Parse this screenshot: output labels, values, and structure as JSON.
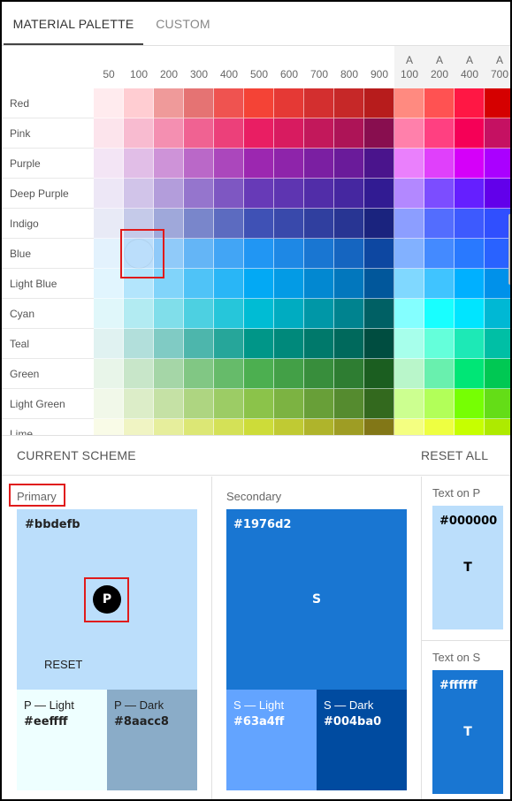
{
  "tabs": [
    {
      "label": "MATERIAL PALETTE",
      "active": true
    },
    {
      "label": "CUSTOM",
      "active": false
    }
  ],
  "palette": {
    "columns": [
      {
        "label": "50",
        "accent_prefix": ""
      },
      {
        "label": "100",
        "accent_prefix": ""
      },
      {
        "label": "200",
        "accent_prefix": ""
      },
      {
        "label": "300",
        "accent_prefix": ""
      },
      {
        "label": "400",
        "accent_prefix": ""
      },
      {
        "label": "500",
        "accent_prefix": ""
      },
      {
        "label": "600",
        "accent_prefix": ""
      },
      {
        "label": "700",
        "accent_prefix": ""
      },
      {
        "label": "800",
        "accent_prefix": ""
      },
      {
        "label": "900",
        "accent_prefix": ""
      },
      {
        "label": "100",
        "accent_prefix": "A"
      },
      {
        "label": "200",
        "accent_prefix": "A"
      },
      {
        "label": "400",
        "accent_prefix": "A"
      },
      {
        "label": "700",
        "accent_prefix": "A"
      }
    ],
    "rows": [
      {
        "name": "Red",
        "colors": [
          "#ffebee",
          "#ffcdd2",
          "#ef9a9a",
          "#e57373",
          "#ef5350",
          "#f44336",
          "#e53935",
          "#d32f2f",
          "#c62828",
          "#b71c1c",
          "#ff8a80",
          "#ff5252",
          "#ff1744",
          "#d50000"
        ]
      },
      {
        "name": "Pink",
        "colors": [
          "#fce4ec",
          "#f8bbd0",
          "#f48fb1",
          "#f06292",
          "#ec407a",
          "#e91e63",
          "#d81b60",
          "#c2185b",
          "#ad1457",
          "#880e4f",
          "#ff80ab",
          "#ff4081",
          "#f50057",
          "#c51162"
        ]
      },
      {
        "name": "Purple",
        "colors": [
          "#f3e5f5",
          "#e1bee7",
          "#ce93d8",
          "#ba68c8",
          "#ab47bc",
          "#9c27b0",
          "#8e24aa",
          "#7b1fa2",
          "#6a1b9a",
          "#4a148c",
          "#ea80fc",
          "#e040fb",
          "#d500f9",
          "#aa00ff"
        ]
      },
      {
        "name": "Deep Purple",
        "colors": [
          "#ede7f6",
          "#d1c4e9",
          "#b39ddb",
          "#9575cd",
          "#7e57c2",
          "#673ab7",
          "#5e35b1",
          "#512da8",
          "#4527a0",
          "#311b92",
          "#b388ff",
          "#7c4dff",
          "#651fff",
          "#6200ea"
        ]
      },
      {
        "name": "Indigo",
        "colors": [
          "#e8eaf6",
          "#c5cae9",
          "#9fa8da",
          "#7986cb",
          "#5c6bc0",
          "#3f51b5",
          "#3949ab",
          "#303f9f",
          "#283593",
          "#1a237e",
          "#8c9eff",
          "#536dfe",
          "#3d5afe",
          "#304ffe"
        ]
      },
      {
        "name": "Blue",
        "colors": [
          "#e3f2fd",
          "#bbdefb",
          "#90caf9",
          "#64b5f6",
          "#42a5f5",
          "#2196f3",
          "#1e88e5",
          "#1976d2",
          "#1565c0",
          "#0d47a1",
          "#82b1ff",
          "#448aff",
          "#2979ff",
          "#2962ff"
        ]
      },
      {
        "name": "Light Blue",
        "colors": [
          "#e1f5fe",
          "#b3e5fc",
          "#81d4fa",
          "#4fc3f7",
          "#29b6f6",
          "#03a9f4",
          "#039be5",
          "#0288d1",
          "#0277bd",
          "#01579b",
          "#80d8ff",
          "#40c4ff",
          "#00b0ff",
          "#0091ea"
        ]
      },
      {
        "name": "Cyan",
        "colors": [
          "#e0f7fa",
          "#b2ebf2",
          "#80deea",
          "#4dd0e1",
          "#26c6da",
          "#00bcd4",
          "#00acc1",
          "#0097a7",
          "#00838f",
          "#006064",
          "#84ffff",
          "#18ffff",
          "#00e5ff",
          "#00b8d4"
        ]
      },
      {
        "name": "Teal",
        "colors": [
          "#e0f2f1",
          "#b2dfdb",
          "#80cbc4",
          "#4db6ac",
          "#26a69a",
          "#009688",
          "#00897b",
          "#00796b",
          "#00695c",
          "#004d40",
          "#a7ffeb",
          "#64ffda",
          "#1de9b6",
          "#00bfa5"
        ]
      },
      {
        "name": "Green",
        "colors": [
          "#e8f5e9",
          "#c8e6c9",
          "#a5d6a7",
          "#81c784",
          "#66bb6a",
          "#4caf50",
          "#43a047",
          "#388e3c",
          "#2e7d32",
          "#1b5e20",
          "#b9f6ca",
          "#69f0ae",
          "#00e676",
          "#00c853"
        ]
      },
      {
        "name": "Light Green",
        "colors": [
          "#f1f8e9",
          "#dcedc8",
          "#c5e1a5",
          "#aed581",
          "#9ccc65",
          "#8bc34a",
          "#7cb342",
          "#689f38",
          "#558b2f",
          "#33691e",
          "#ccff90",
          "#b2ff59",
          "#76ff03",
          "#64dd17"
        ]
      },
      {
        "name": "Lime",
        "colors": [
          "#f9fbe7",
          "#f0f4c3",
          "#e6ee9c",
          "#dce775",
          "#d4e157",
          "#cddc39",
          "#c0ca33",
          "#afb42b",
          "#9e9d24",
          "#827717",
          "#f4ff81",
          "#eeff41",
          "#c6ff00",
          "#aeea00"
        ]
      }
    ],
    "selected": {
      "row": "Blue",
      "column": "100",
      "color": "#bbdefb"
    }
  },
  "scheme": {
    "title": "CURRENT SCHEME",
    "reset_all": "RESET ALL",
    "primary": {
      "label": "Primary",
      "hex": "#bbdefb",
      "color": "#bbdefb",
      "letter": "P",
      "reset": "RESET",
      "light": {
        "name": "P — Light",
        "hex": "#eeffff",
        "color": "#eeffff"
      },
      "dark": {
        "name": "P — Dark",
        "hex": "#8aacc8",
        "color": "#8aacc8"
      }
    },
    "secondary": {
      "label": "Secondary",
      "hex": "#1976d2",
      "color": "#1976d2",
      "letter": "S",
      "light": {
        "name": "S — Light",
        "hex": "#63a4ff",
        "color": "#63a4ff"
      },
      "dark": {
        "name": "S — Dark",
        "hex": "#004ba0",
        "color": "#004ba0"
      }
    },
    "text_on_p": {
      "label": "Text on P",
      "hex": "#000000",
      "letter": "T",
      "color": "#bbdefb"
    },
    "text_on_s": {
      "label": "Text on S",
      "hex": "#ffffff",
      "letter": "T",
      "color": "#1976d2"
    }
  }
}
